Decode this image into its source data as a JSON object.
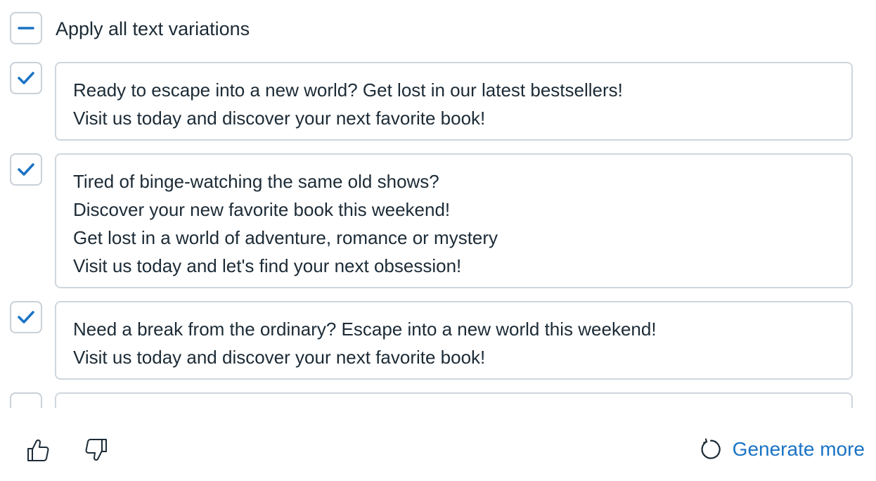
{
  "apply_all": {
    "label": "Apply all text variations",
    "state": "indeterminate"
  },
  "variations": [
    {
      "checked": true,
      "lines": [
        "Ready to escape into a new world? Get lost in our latest bestsellers!",
        "Visit us today and discover your next favorite book!"
      ]
    },
    {
      "checked": true,
      "lines": [
        "Tired of binge-watching the same old shows?",
        "Discover your new favorite book this weekend!",
        "Get lost in a world of adventure, romance or mystery",
        "Visit us today and let's find your next obsession!"
      ]
    },
    {
      "checked": true,
      "lines": [
        "Need a break from the ordinary? Escape into a new world this weekend!",
        "Visit us today and discover your next favorite book!"
      ]
    }
  ],
  "footer": {
    "thumbs_up_icon": "thumbs-up-icon",
    "thumbs_down_icon": "thumbs-down-icon",
    "generate_more_label": "Generate more",
    "generate_more_icon": "refresh-icon"
  },
  "colors": {
    "accent": "#1a73c4",
    "border": "#cfd6de",
    "text": "#1c2b36"
  }
}
